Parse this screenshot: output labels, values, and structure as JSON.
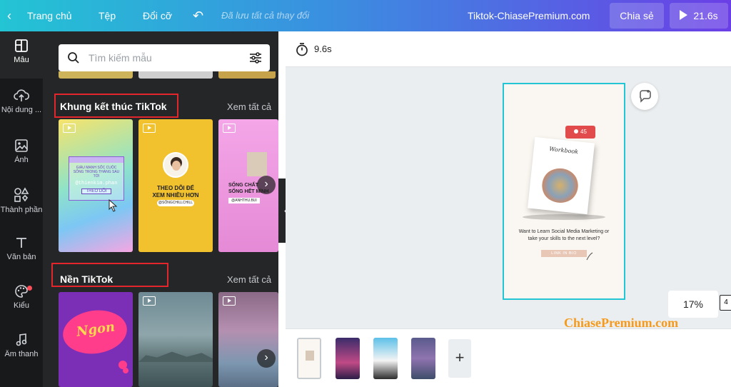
{
  "topbar": {
    "home": "Trang chủ",
    "file": "Tệp",
    "resize": "Đổi cỡ",
    "saved": "Đã lưu tất cả thay đổi",
    "doc_title": "Tiktok-ChiasePremium.com",
    "share": "Chia sẻ",
    "play": "21.6s"
  },
  "rail": {
    "templates": "Mẫu",
    "uploads": "Nội dung ...",
    "photos": "Ảnh",
    "elements": "Thành phần",
    "text": "Văn bản",
    "styles": "Kiểu",
    "audio": "Âm thanh"
  },
  "panel": {
    "search_placeholder": "Tìm kiếm mẫu",
    "section1": {
      "title": "Khung kết thúc TikTok",
      "see_all": "Xem tất cả"
    },
    "section2": {
      "title": "Nền TikTok",
      "see_all": "Xem tất cả"
    },
    "thumb1": {
      "lines": "GIÀU MẠNH SỐC CUỘC SỐNG TRONG THÁNG SÁU TỚI",
      "handle": "@thienkim.phan",
      "button": "THEO DÕI"
    },
    "thumb2": {
      "line1": "THEO DÕI ĐỂ",
      "line2": "XEM NHIỀU HƠN",
      "handle": "@SỐNGCHILLCHILL"
    },
    "thumb3": {
      "line1": "SỐNG CHẤT",
      "line2": "SỐNG HẾT MÌNH",
      "handle": "@ANHTHU.BUI"
    },
    "thumb4": {
      "word": "Ngon"
    }
  },
  "editor": {
    "timer": "9.6s",
    "zoom": "17%",
    "page_count": "4",
    "watermark": "ChiasePremium.com",
    "page": {
      "badge": "45",
      "book_title": "Workbook",
      "caption": "Want to Learn Social Media Marketing or take your skills to the next level?",
      "button": "LINK IN BIO"
    }
  },
  "colors": {
    "accent": "#23c4d4",
    "purple": "#6b3fe6",
    "highlight_red": "#e2262c",
    "watermark_orange": "#f59a1b"
  }
}
